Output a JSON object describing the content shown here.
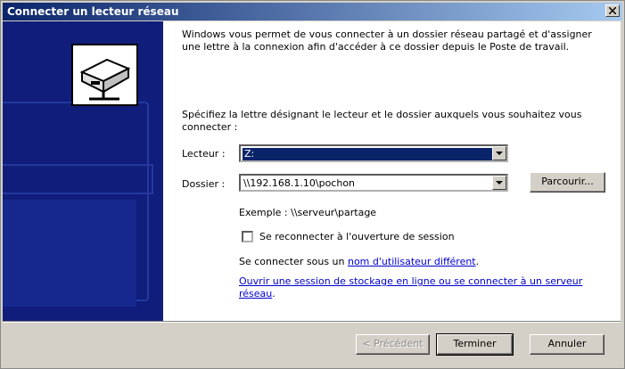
{
  "window": {
    "title": "Connecter un lecteur réseau"
  },
  "intro": {
    "paragraph1": "Windows vous permet de vous connecter à un dossier réseau partagé et d'assigner une lettre à la connexion afin d'accéder à ce dossier depuis le Poste de travail.",
    "paragraph2": "Spécifiez la lettre désignant le lecteur et le dossier auxquels vous souhaitez vous connecter :"
  },
  "form": {
    "drive_label": "Lecteur :",
    "drive_value": "Z:",
    "folder_label": "Dossier :",
    "folder_value": "\\\\192.168.1.10\\pochon",
    "browse_button": "Parcourir...",
    "example": "Exemple : \\\\serveur\\partage",
    "reconnect_label": "Se reconnecter à l'ouverture de session",
    "reconnect_checked": false,
    "other_user_prefix": "Se connecter sous un ",
    "other_user_link": "nom d'utilisateur différent",
    "other_user_suffix": ".",
    "storage_link": "Ouvrir une session de stockage en ligne ou se connecter à un serveur réseau",
    "storage_suffix": "."
  },
  "buttons": {
    "back": "< Précédent",
    "finish": "Terminer",
    "cancel": "Annuler"
  },
  "colors": {
    "titlebar_start": "#0a246a",
    "titlebar_end": "#a6caf0",
    "side_panel": "#101d7a",
    "link": "#0000cc",
    "dialog_bg": "#d4d0c8"
  }
}
